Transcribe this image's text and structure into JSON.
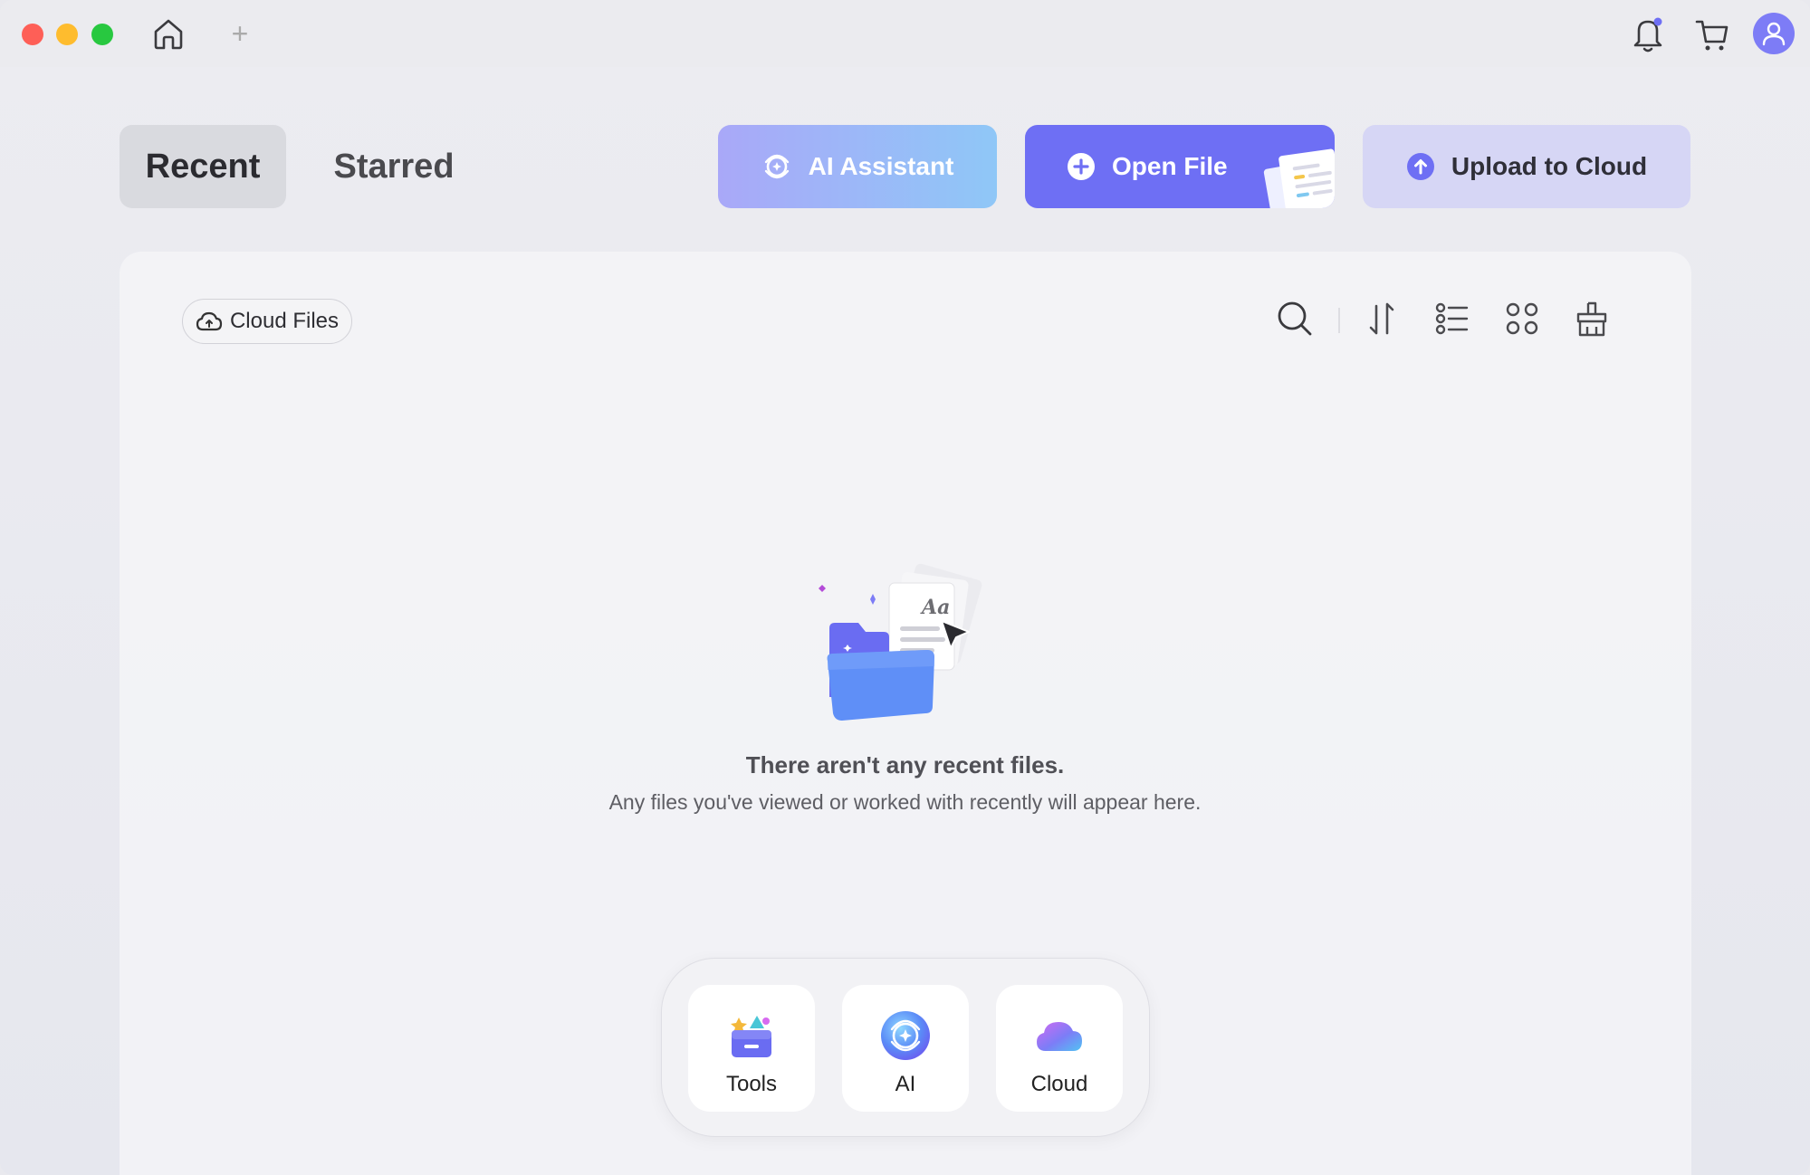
{
  "window": {
    "controls": [
      "close",
      "minimize",
      "maximize"
    ],
    "home_icon": "home-icon",
    "new_tab_label": "+"
  },
  "header": {
    "notification_icon": "bell-icon",
    "cart_icon": "cart-icon",
    "avatar_icon": "user-icon"
  },
  "tabs": [
    {
      "label": "Recent",
      "selected": true
    },
    {
      "label": "Starred",
      "selected": false
    }
  ],
  "actions": {
    "ai_assistant": "AI Assistant",
    "open_file": "Open File",
    "upload_to_cloud": "Upload to Cloud"
  },
  "toolbar": {
    "cloud_files": "Cloud Files",
    "icons": [
      "search-icon",
      "sort-icon",
      "list-view-icon",
      "grid-view-icon",
      "clean-icon"
    ]
  },
  "empty_state": {
    "title": "There aren't any recent files.",
    "subtitle": "Any files you've viewed or worked with recently will appear here."
  },
  "dock": [
    {
      "label": "Tools",
      "icon": "tools-icon"
    },
    {
      "label": "AI",
      "icon": "ai-icon"
    },
    {
      "label": "Cloud",
      "icon": "cloud-icon"
    }
  ],
  "colors": {
    "accent": "#6e6ff4",
    "ai_gradient_start": "#a9a8f8",
    "ai_gradient_end": "#8fc7f7",
    "upload_bg": "#d6d6f5",
    "close": "#fe5f57",
    "minimize": "#febc2e",
    "maximize": "#28c840"
  }
}
